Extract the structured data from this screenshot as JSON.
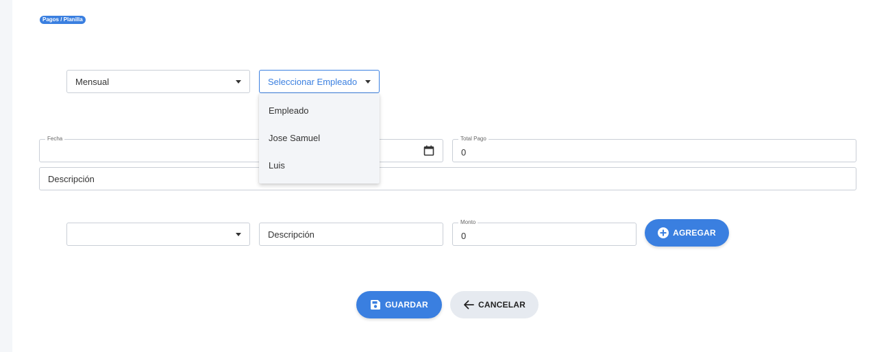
{
  "breadcrumb": "Pagos / Planilla",
  "period_select": {
    "value": "Mensual"
  },
  "employee_select": {
    "value": "Seleccionar Empleado",
    "options": [
      "Empleado",
      "Jose Samuel",
      "Luis"
    ]
  },
  "fecha": {
    "label": "Fecha",
    "value": ""
  },
  "total_pago": {
    "label": "Total Pago",
    "value": "0"
  },
  "descripcion": {
    "value": "Descripción"
  },
  "detail": {
    "type_select_value": "",
    "descripcion": "Descripción",
    "monto_label": "Monto",
    "monto_value": "0",
    "add_label": "AGREGAR"
  },
  "actions": {
    "save_label": "GUARDAR",
    "cancel_label": "CANCELAR"
  },
  "colors": {
    "accent": "#3a7fe0",
    "secondary": "#e6eaf0"
  }
}
